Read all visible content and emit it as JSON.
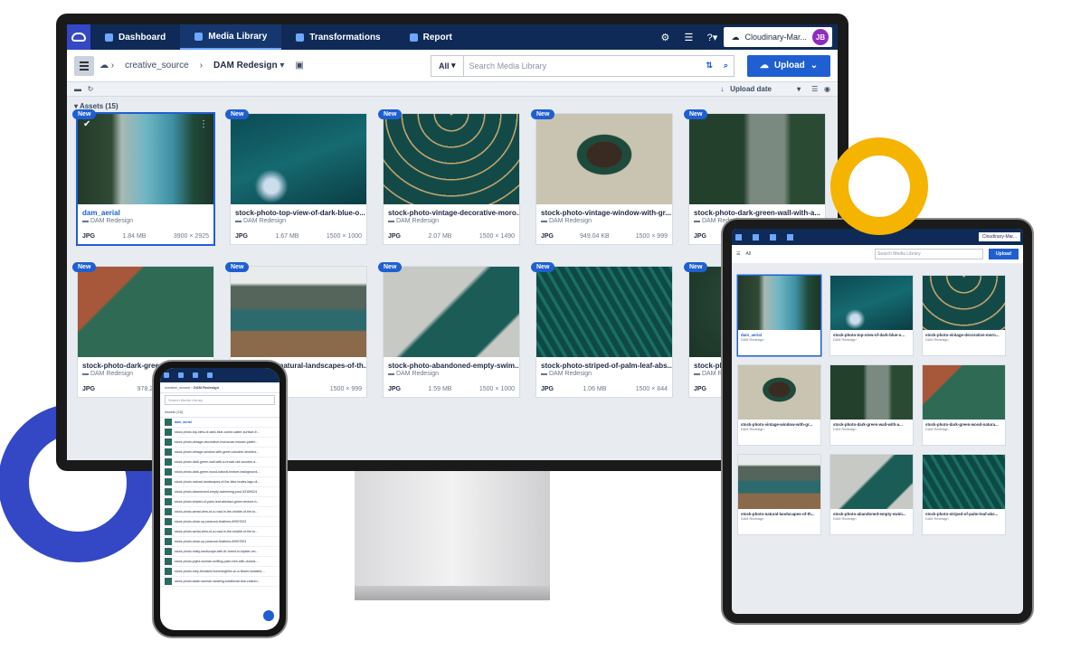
{
  "nav": {
    "tabs": [
      {
        "label": "Dashboard"
      },
      {
        "label": "Media Library"
      },
      {
        "label": "Transformations"
      },
      {
        "label": "Report"
      }
    ],
    "account": "Cloudinary-Mar...",
    "avatar_initials": "JB"
  },
  "breadcrumb": {
    "root": "creative_source",
    "current": "DAM Redesign"
  },
  "search": {
    "scope": "All",
    "placeholder": "Search Media Library"
  },
  "upload_label": "Upload",
  "sort_label": "Upload date",
  "assets_heading": "Assets (15)",
  "badge_new": "New",
  "folder_name": "DAM Redesign",
  "assets": [
    {
      "name": "dam_aerial",
      "format": "JPG",
      "size": "1.84 MB",
      "dims": "3900 × 2925",
      "thumb": "t-aerial",
      "selected": true
    },
    {
      "name": "stock-photo-top-view-of-dark-blue-o...",
      "format": "JPG",
      "size": "1.67 MB",
      "dims": "1500 × 1000",
      "thumb": "t-ocean"
    },
    {
      "name": "stock-photo-vintage-decorative-moro...",
      "format": "JPG",
      "size": "2.07 MB",
      "dims": "1500 × 1490",
      "thumb": "t-pattern"
    },
    {
      "name": "stock-photo-vintage-window-with-gr...",
      "format": "JPG",
      "size": "949.04 KB",
      "dims": "1500 × 999",
      "thumb": "t-window"
    },
    {
      "name": "stock-photo-dark-green-wall-with-a...",
      "format": "JPG",
      "size": "",
      "dims": "",
      "thumb": "t-door"
    },
    {
      "name": "stock-photo-dark-green-wood-natura...",
      "format": "JPG",
      "size": "978.29 KB",
      "dims": "",
      "thumb": "t-wood"
    },
    {
      "name": "stock-photo-natural-landscapes-of-th...",
      "format": "JPG",
      "size": "",
      "dims": "1500 × 999",
      "thumb": "t-lake"
    },
    {
      "name": "stock-photo-abandoned-empty-swim...",
      "format": "JPG",
      "size": "1.59 MB",
      "dims": "1500 × 1000",
      "thumb": "t-pool"
    },
    {
      "name": "stock-photo-striped-of-palm-leaf-abs...",
      "format": "JPG",
      "size": "1.06 MB",
      "dims": "1500 × 844",
      "thumb": "t-palm"
    },
    {
      "name": "stock-pl...",
      "format": "JPG",
      "size": "",
      "dims": "",
      "thumb": "t-forest"
    }
  ],
  "phone_list": [
    "dam_aerial",
    "stock-photo-top-view-of-dark-blue-ocean-water-surface-fr...",
    "stock-photo-vintage-decorative-moroccan-mosaic-patter...",
    "stock-photo-vintage-window-with-green-wooden-shutters...",
    "stock-photo-dark-green-wall-with-a-brown-old-wooden-d...",
    "stock-photo-dark-green-wood-natural-texture-background...",
    "stock-photo-natural-landscapes-of-the-lake-braies-lago-di...",
    "stock-photo-abandoned-empty-swimming-pool-93159024",
    "stock-photo-striped-of-palm-leaf-abstract-green-texture-b...",
    "stock-photo-aerial-view-of-a-road-in-the-middle-of-the-fo...",
    "stock-photo-close-up-peacock-feathers-69907003",
    "stock-photo-aerial-view-of-a-road-in-the-middle-of-the-fo...",
    "stock-photo-close-up-peacock-feathers-69907003",
    "stock-photo-misty-landscape-with-fir-forest-in-hipster-vin...",
    "stock-photo-joyful-woman-sniffing-palm-tree-with-closed-...",
    "stock-photo-ruby-throated-hummingbird-on-a-flower-isolated-...",
    "stock-photo-asian-woman-wearing-traditional-thai-costum..."
  ],
  "tablet_cards": [
    {
      "name": "dam_aerial",
      "thumb": "t-aerial",
      "selected": true
    },
    {
      "name": "stock-photo-top-view-of-dark-blue-o...",
      "thumb": "t-ocean"
    },
    {
      "name": "stock-photo-vintage-decorative-moro...",
      "thumb": "t-pattern"
    },
    {
      "name": "stock-photo-vintage-window-with-gr...",
      "thumb": "t-window"
    },
    {
      "name": "stock-photo-dark-green-wall-with-a...",
      "thumb": "t-door"
    },
    {
      "name": "stock-photo-dark-green-wood-natura...",
      "thumb": "t-wood"
    },
    {
      "name": "stock-photo-natural-landscapes-of-th...",
      "thumb": "t-lake"
    },
    {
      "name": "stock-photo-abandoned-empty-swim...",
      "thumb": "t-pool"
    },
    {
      "name": "stock-photo-striped-of-palm-leaf-abs...",
      "thumb": "t-palm"
    }
  ],
  "colors": {
    "nav_bg": "#0f2a56",
    "accent": "#1f5fd1",
    "ring_yellow": "#f4b400",
    "ring_blue": "#3448c5"
  }
}
